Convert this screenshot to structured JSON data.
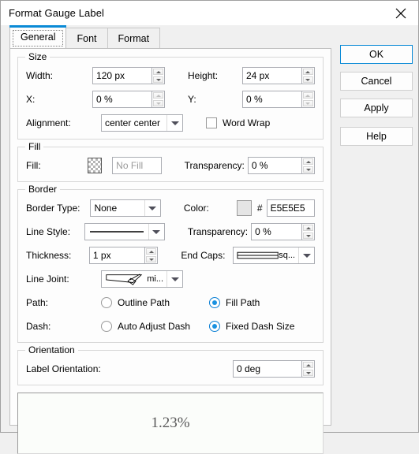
{
  "window": {
    "title": "Format Gauge Label",
    "close_icon": "close-icon"
  },
  "tabs": [
    {
      "label": "General",
      "active": true
    },
    {
      "label": "Font",
      "active": false
    },
    {
      "label": "Format",
      "active": false
    }
  ],
  "buttons": {
    "ok": "OK",
    "cancel": "Cancel",
    "apply": "Apply",
    "help": "Help"
  },
  "size": {
    "title": "Size",
    "width_label": "Width:",
    "width_value": "120 px",
    "height_label": "Height:",
    "height_value": "24 px",
    "x_label": "X:",
    "x_value": "0 %",
    "y_label": "Y:",
    "y_value": "0 %",
    "alignment_label": "Alignment:",
    "alignment_value": "center center",
    "word_wrap_label": "Word Wrap",
    "word_wrap_checked": false
  },
  "fill": {
    "title": "Fill",
    "fill_label": "Fill:",
    "fill_swatch": "transparent-checker",
    "fill_value_placeholder": "No Fill",
    "transparency_label": "Transparency:",
    "transparency_value": "0 %"
  },
  "border": {
    "title": "Border",
    "border_type_label": "Border Type:",
    "border_type_value": "None",
    "color_label": "Color:",
    "color_swatch_hex": "#E5E5E5",
    "hash_symbol": "#",
    "color_hex_value": "E5E5E5",
    "line_style_label": "Line Style:",
    "line_style_value": "solid-line",
    "transparency_label": "Transparency:",
    "transparency_value": "0 %",
    "thickness_label": "Thickness:",
    "thickness_value": "1 px",
    "end_caps_label": "End Caps:",
    "end_caps_value": "sq...",
    "line_joint_label": "Line Joint:",
    "line_joint_value": "mi...",
    "path_label": "Path:",
    "path_outline_label": "Outline Path",
    "path_fill_label": "Fill Path",
    "path_selected": "fill",
    "dash_label": "Dash:",
    "dash_auto_label": "Auto Adjust Dash",
    "dash_fixed_label": "Fixed Dash Size",
    "dash_selected": "fixed"
  },
  "orientation": {
    "title": "Orientation",
    "label_orientation_label": "Label Orientation:",
    "label_orientation_value": "0 deg"
  },
  "preview": {
    "text": "1.23%"
  },
  "colors": {
    "accent": "#0a8ad6",
    "radio_fill": "#1a91e0",
    "border_color_swatch": "#E5E5E5"
  }
}
